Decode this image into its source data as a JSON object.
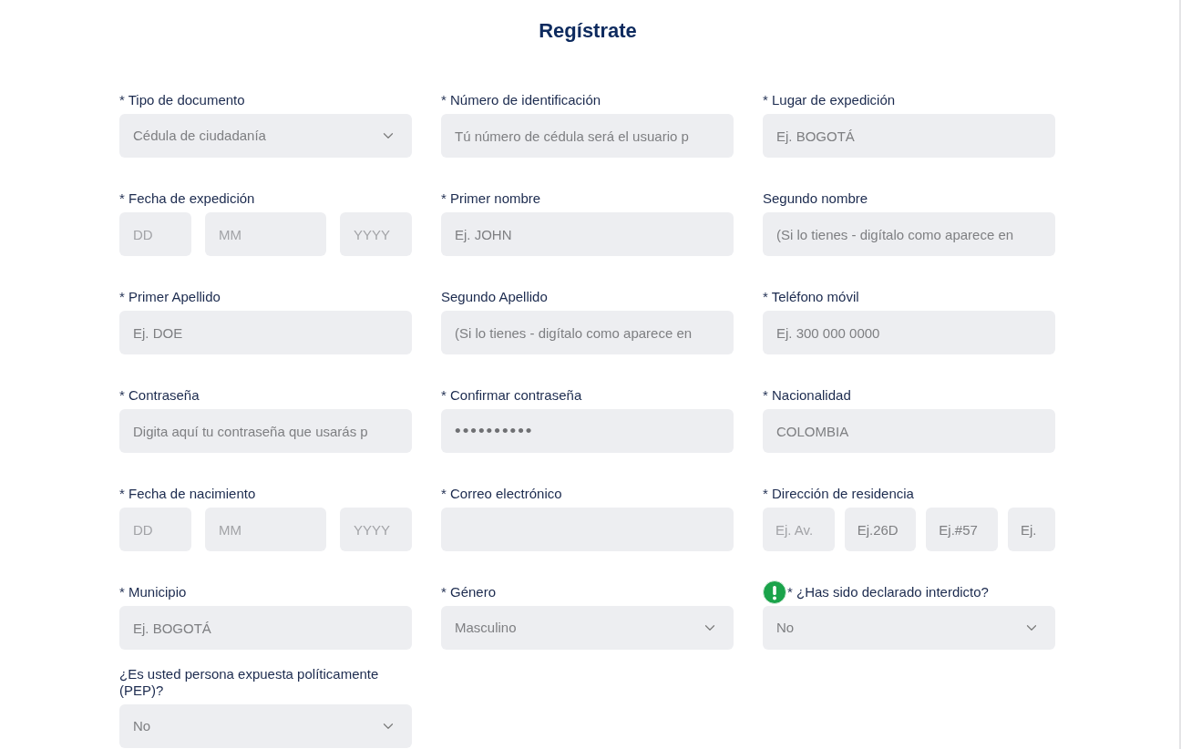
{
  "title": "Regístrate",
  "rows": [
    {
      "fields": [
        {
          "label": "* Tipo de documento",
          "kind": "dropdown",
          "value": "Cédula de ciudadanía",
          "hint": false
        },
        {
          "label": "* Número de identificación",
          "kind": "text",
          "placeholder": "Tú número de cédula será el usuario p",
          "hint": false
        },
        {
          "label": "* Lugar de expedición",
          "kind": "text",
          "placeholder": "Ej. BOGOTÁ",
          "hint": false
        }
      ]
    },
    {
      "fields": [
        {
          "label": "* Fecha de expedición",
          "kind": "date",
          "hint": false,
          "parts": [
            {
              "kind": "picker",
              "placeholder": "DD"
            },
            {
              "kind": "picker",
              "placeholder": "MM"
            },
            {
              "kind": "picker",
              "placeholder": "YYYY"
            }
          ]
        },
        {
          "label": "* Primer nombre",
          "kind": "text",
          "placeholder": "Ej. JOHN",
          "hint": false
        },
        {
          "label": "Segundo nombre",
          "kind": "text",
          "placeholder": "(Si lo tienes - digítalo como aparece en",
          "hint": false
        }
      ]
    },
    {
      "fields": [
        {
          "label": "* Primer Apellido",
          "kind": "text",
          "placeholder": "Ej. DOE",
          "hint": false
        },
        {
          "label": "Segundo Apellido",
          "kind": "text",
          "placeholder": "(Si lo tienes - digítalo como aparece en",
          "hint": false
        },
        {
          "label": "* Teléfono móvil",
          "kind": "text",
          "placeholder": "Ej. 300 000 0000",
          "hint": false
        }
      ]
    },
    {
      "fields": [
        {
          "label": "* Contraseña",
          "kind": "text",
          "placeholder": "Digita aquí tu contraseña que usarás p",
          "hint": false
        },
        {
          "label": "* Confirmar contraseña",
          "kind": "text",
          "value": "••••••••••",
          "hint": false
        },
        {
          "label": "* Nacionalidad",
          "kind": "text",
          "placeholder": "COLOMBIA",
          "hint": false
        }
      ]
    },
    {
      "fields": [
        {
          "label": "* Fecha de nacimiento",
          "kind": "date",
          "hint": false,
          "parts": [
            {
              "kind": "picker",
              "placeholder": "DD"
            },
            {
              "kind": "picker",
              "placeholder": "MM"
            },
            {
              "kind": "picker",
              "placeholder": "YYYY"
            }
          ]
        },
        {
          "label": "* Correo electrónico",
          "kind": "text",
          "hint": false
        },
        {
          "label": "* Dirección de residencia",
          "kind": "address",
          "hint": false,
          "parts": [
            {
              "kind": "picker",
              "placeholder": "Ej. Av."
            },
            {
              "kind": "text",
              "placeholder": "Ej.26D"
            },
            {
              "kind": "text",
              "placeholder": "Ej.#57"
            },
            {
              "kind": "text",
              "placeholder": "Ej."
            }
          ]
        }
      ]
    },
    {
      "fields": [
        {
          "label": "* Municipio",
          "kind": "text",
          "placeholder": "Ej. BOGOTÁ",
          "hint": false
        },
        {
          "label": "* Género",
          "kind": "dropdown",
          "value": "Masculino",
          "hint": false
        },
        {
          "label": "* ¿Has sido declarado interdicto?",
          "kind": "dropdown",
          "value": "No",
          "hint": true
        }
      ]
    },
    {
      "fields": [
        {
          "label": "¿Es usted persona expuesta políticamente (PEP)?",
          "kind": "dropdown",
          "value": "No",
          "hint": false
        }
      ]
    }
  ]
}
